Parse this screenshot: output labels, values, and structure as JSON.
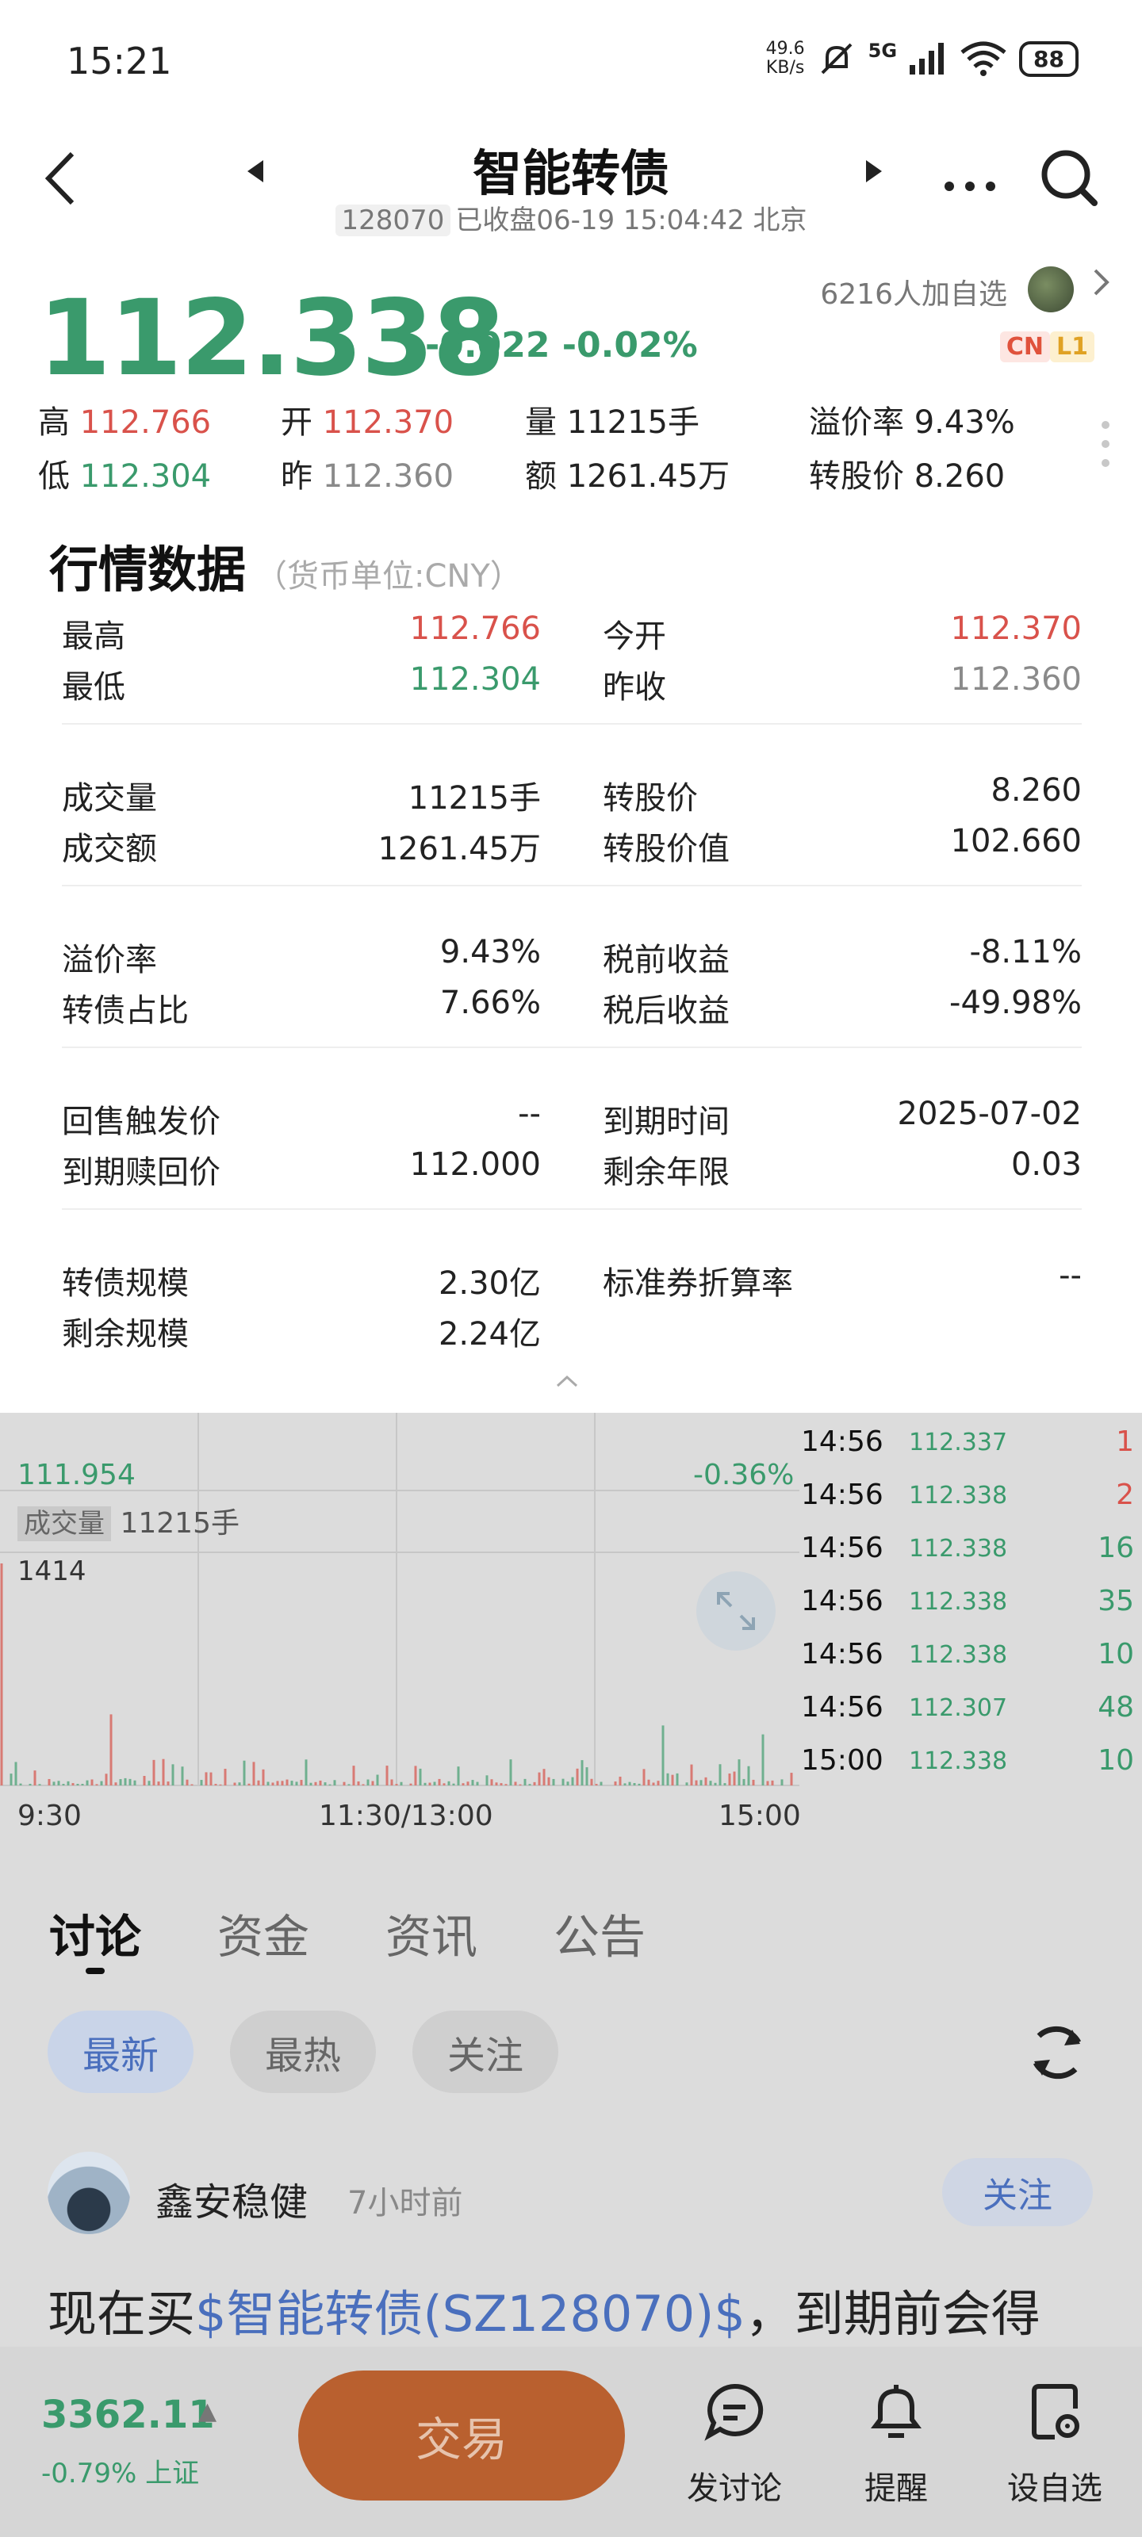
{
  "status_bar": {
    "time": "15:21",
    "netspeed_value": "49.6",
    "netspeed_unit": "KB/s",
    "network": "5G",
    "battery": "88"
  },
  "header": {
    "title": "智能转债",
    "code": "128070",
    "status_text": "已收盘06-19 15:04:42 北京"
  },
  "quote": {
    "price": "112.338",
    "change": "-0.022 -0.02%",
    "watch_count": "6216人加自选",
    "badge_cn": "CN",
    "badge_l1": "L1",
    "row1": [
      {
        "label": "高",
        "value": "112.766",
        "color": "red"
      },
      {
        "label": "开",
        "value": "112.370",
        "color": "red"
      },
      {
        "label": "量",
        "value": "11215手",
        "color": "dark"
      },
      {
        "label": "溢价率",
        "value": "9.43%",
        "color": "dark"
      }
    ],
    "row2": [
      {
        "label": "低",
        "value": "112.304",
        "color": "green"
      },
      {
        "label": "昨",
        "value": "112.360",
        "color": "gray"
      },
      {
        "label": "额",
        "value": "1261.45万",
        "color": "dark"
      },
      {
        "label": "转股价",
        "value": "8.260",
        "color": "dark"
      }
    ]
  },
  "market": {
    "title": "行情数据",
    "unit": "（货币单位:CNY）",
    "groups": [
      {
        "left": [
          {
            "label": "最高",
            "value": "112.766",
            "color": "red"
          },
          {
            "label": "最低",
            "value": "112.304",
            "color": "green"
          }
        ],
        "right": [
          {
            "label": "今开",
            "value": "112.370",
            "color": "red"
          },
          {
            "label": "昨收",
            "value": "112.360",
            "color": "gray"
          }
        ]
      },
      {
        "left": [
          {
            "label": "成交量",
            "value": "11215手",
            "color": "dark"
          },
          {
            "label": "成交额",
            "value": "1261.45万",
            "color": "dark"
          }
        ],
        "right": [
          {
            "label": "转股价",
            "value": "8.260",
            "color": "dark"
          },
          {
            "label": "转股价值",
            "value": "102.660",
            "color": "dark"
          }
        ]
      },
      {
        "left": [
          {
            "label": "溢价率",
            "value": "9.43%",
            "color": "dark"
          },
          {
            "label": "转债占比",
            "value": "7.66%",
            "color": "dark"
          }
        ],
        "right": [
          {
            "label": "税前收益",
            "value": "-8.11%",
            "color": "dark"
          },
          {
            "label": "税后收益",
            "value": "-49.98%",
            "color": "dark"
          }
        ]
      },
      {
        "left": [
          {
            "label": "回售触发价",
            "value": "--",
            "color": "dark"
          },
          {
            "label": "到期赎回价",
            "value": "112.000",
            "color": "dark"
          }
        ],
        "right": [
          {
            "label": "到期时间",
            "value": "2025-07-02",
            "color": "dark"
          },
          {
            "label": "剩余年限",
            "value": "0.03",
            "color": "dark"
          }
        ]
      },
      {
        "left": [
          {
            "label": "转债规模",
            "value": "2.30亿",
            "color": "dark"
          },
          {
            "label": "剩余规模",
            "value": "2.24亿",
            "color": "dark"
          }
        ],
        "right": [
          {
            "label": "标准券折算率",
            "value": "--",
            "color": "dark"
          }
        ]
      }
    ]
  },
  "chart": {
    "low_price": "111.954",
    "low_pct": "-0.36%",
    "volume_label": "成交量",
    "volume_value": "11215手",
    "volume_max": "1414",
    "time_axis": [
      "9:30",
      "11:30/13:00",
      "15:00"
    ],
    "ticks": [
      {
        "time": "14:56",
        "price": "112.337",
        "vol": "1",
        "color": "red"
      },
      {
        "time": "14:56",
        "price": "112.338",
        "vol": "2",
        "color": "red"
      },
      {
        "time": "14:56",
        "price": "112.338",
        "vol": "16",
        "color": "green"
      },
      {
        "time": "14:56",
        "price": "112.338",
        "vol": "35",
        "color": "green"
      },
      {
        "time": "14:56",
        "price": "112.338",
        "vol": "10",
        "color": "green"
      },
      {
        "time": "14:56",
        "price": "112.307",
        "vol": "48",
        "color": "green"
      },
      {
        "time": "15:00",
        "price": "112.338",
        "vol": "10",
        "color": "green"
      }
    ]
  },
  "tabs": [
    "讨论",
    "资金",
    "资讯",
    "公告"
  ],
  "filters": [
    "最新",
    "最热",
    "关注"
  ],
  "post": {
    "user": "鑫安稳健",
    "time": "7小时前",
    "follow": "关注",
    "text_prefix": "现在买",
    "text_link": "$智能转债(SZ128070)$",
    "text_suffix": "，到期前会得"
  },
  "bottom": {
    "index_value": "3362.11",
    "index_arrow": "▲",
    "index_change": "-0.79% 上证",
    "trade": "交易",
    "items": [
      "发讨论",
      "提醒",
      "设自选"
    ]
  }
}
